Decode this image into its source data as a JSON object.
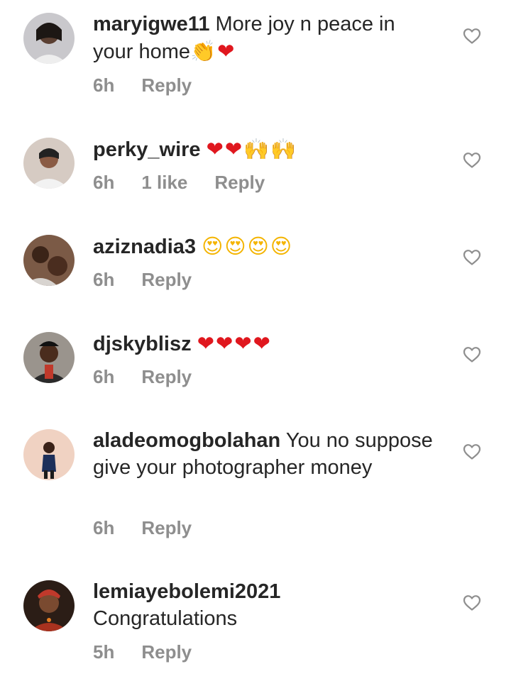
{
  "comments": [
    {
      "username": "maryigwe11",
      "text": "More joy n peace in your home",
      "emoji": "👏❤️",
      "time": "6h",
      "likes": "",
      "reply": "Reply",
      "avatar_color": "#b9b7bd"
    },
    {
      "username": "perky_wire",
      "text": "",
      "emoji": "❤️❤️🙌🙌",
      "time": "6h",
      "likes": "1 like",
      "reply": "Reply",
      "avatar_color": "#c7b9b0"
    },
    {
      "username": "aziznadia3",
      "text": "",
      "emoji": "😍😍😍😍",
      "time": "6h",
      "likes": "",
      "reply": "Reply",
      "avatar_color": "#6e4f3d"
    },
    {
      "username": "djskyblisz",
      "text": "",
      "emoji": "❤️❤️❤️❤️",
      "time": "6h",
      "likes": "",
      "reply": "Reply",
      "avatar_color": "#8f8880"
    },
    {
      "username": "aladeomogbolahan",
      "text": "You no suppose give your photographer money",
      "emoji": "",
      "time": "6h",
      "likes": "",
      "reply": "Reply",
      "avatar_color": "#e9c7b3"
    },
    {
      "username": "lemiayebolemi2021",
      "text": "Congratulations",
      "emoji": "",
      "time": "5h",
      "likes": "",
      "reply": "Reply",
      "avatar_color": "#3e2a20"
    }
  ],
  "colors": {
    "text": "#262626",
    "meta": "#8e8e8e",
    "heart_outline": "#8e8e8e",
    "heart_red": "#e0171e"
  },
  "icons": {
    "like": "heart-outline-icon"
  }
}
